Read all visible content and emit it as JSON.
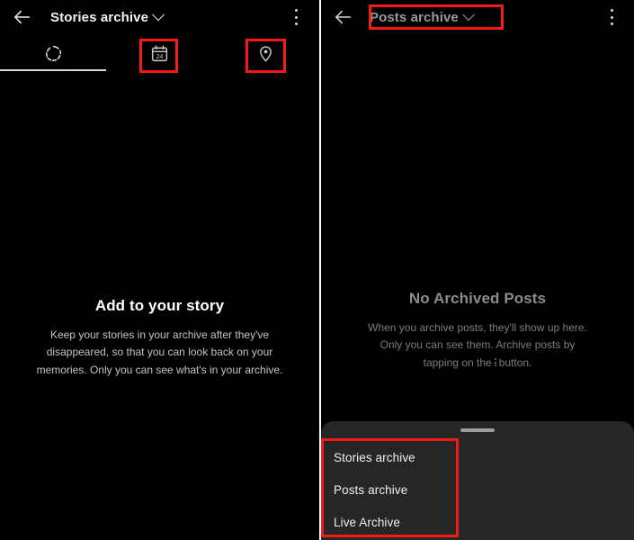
{
  "left_panel": {
    "appbar": {
      "back_icon": "arrow-left-icon",
      "title": "Stories archive",
      "chevron": "chevron-down-icon",
      "overflow_icon": "kebab-menu-icon"
    },
    "tabs": [
      {
        "icon": "stories-circle-icon",
        "label": "Stories",
        "active": true
      },
      {
        "icon": "calendar-24-icon",
        "label": "Calendar",
        "active": false
      },
      {
        "icon": "location-pin-icon",
        "label": "Map",
        "active": false
      }
    ],
    "empty_state": {
      "title": "Add to your story",
      "body": "Keep your stories in your archive after they've disappeared, so that you can look back on your memories. Only you can see what's in your archive."
    }
  },
  "right_panel": {
    "appbar": {
      "back_icon": "arrow-left-icon",
      "title": "Posts archive",
      "chevron": "chevron-down-icon",
      "overflow_icon": "kebab-menu-icon"
    },
    "empty_state": {
      "title": "No Archived Posts",
      "body_part1": "When you archive posts, they'll show up here. Only you can see them. Archive posts by tapping on the",
      "body_part2": "button."
    },
    "bottom_sheet": {
      "handle": "drag-handle",
      "items": [
        {
          "label": "Stories archive"
        },
        {
          "label": "Posts archive"
        },
        {
          "label": "Live Archive"
        }
      ]
    }
  },
  "annotations": {
    "color": "#f61a16",
    "boxes": [
      {
        "name": "calendar-tab-highlight"
      },
      {
        "name": "location-tab-highlight"
      },
      {
        "name": "posts-archive-title-highlight"
      },
      {
        "name": "archive-menu-items-highlight"
      }
    ]
  }
}
